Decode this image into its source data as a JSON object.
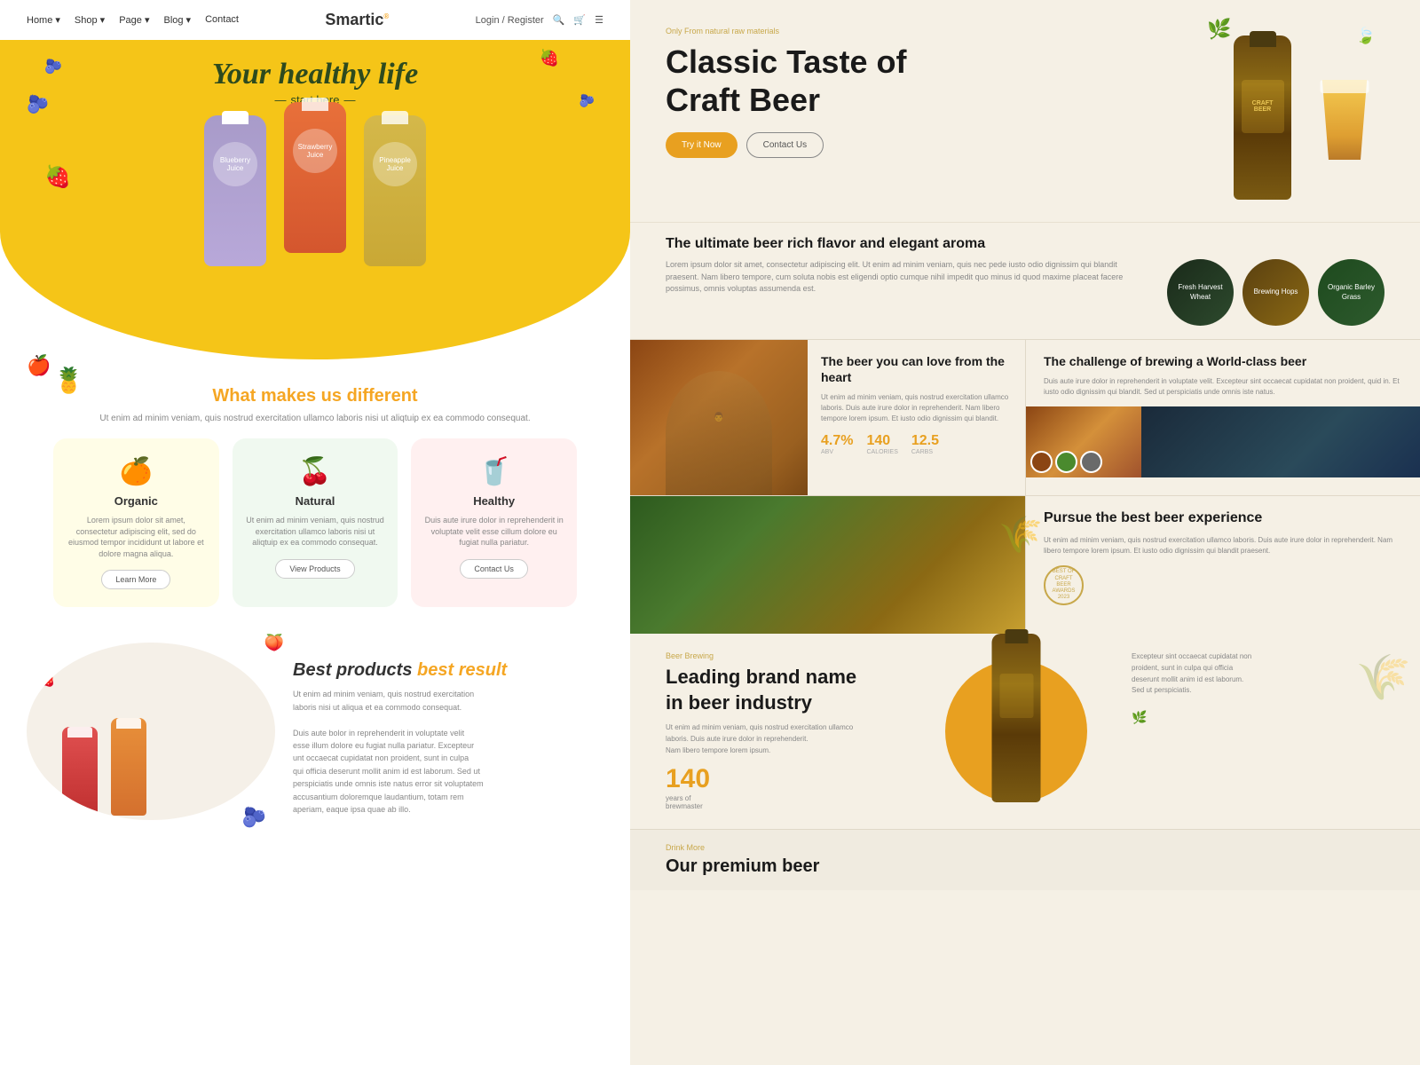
{
  "left": {
    "nav": {
      "links": [
        "Home ▾",
        "Shop ▾",
        "Page ▾",
        "Blog ▾",
        "Contact"
      ],
      "logo": "Smartic",
      "logo_sup": "®",
      "right": [
        "Login / Register",
        "🔍",
        "🛒",
        "☰"
      ]
    },
    "hero": {
      "title": "Your healthy life",
      "subtitle": "start here",
      "bottles": [
        {
          "color": "purple",
          "label": "Blueberry Juice"
        },
        {
          "color": "orange",
          "label": "Strawberry Juice"
        },
        {
          "color": "yellow",
          "label": "Pineapple Juice"
        }
      ]
    },
    "different": {
      "title_start": "What makes us ",
      "title_highlight": "different",
      "desc": "Ut enim ad minim veniam, quis nostrud exercitation ullamco\nlaboris nisi ut aliqtuip ex ea commodo consequat.",
      "cards": [
        {
          "name": "Organic",
          "icon": "🍊",
          "bg": "green",
          "desc": "Lorem ipsum dolor sit amet, consectetur adipiscing elit, sed do eiusmod tempor incididunt ut labore et dolore magna aliqua.",
          "btn": "Learn More"
        },
        {
          "name": "Natural",
          "icon": "🍒",
          "bg": "yellow",
          "desc": "Ut enim ad minim veniam, quis nostrud exercitation ullamco laboris nisi ut aliqtuip ex ea commodo consequat.",
          "btn": "View Products"
        },
        {
          "name": "Healthy",
          "icon": "🥤",
          "bg": "pink",
          "desc": "Duis aute irure dolor in reprehenderit in voluptate velit esse cillum dolore eu fugiat nulla pariatur.",
          "btn": "Contact Us"
        }
      ]
    },
    "products": {
      "label": "Best products",
      "label2": "best result",
      "desc": "Ut enim ad minim veniam, quis nostrud exercitation\nlaboris nisi ut aliqua et ea commodo consequat.\n\nDuis aute bolor in reprehenderit in voluptate velit\nesse illum dolore eu fugiat nulla pariatur. Excepteur\nunt occaecat cupidatat non proident, sunt in culpa\nqui officia deserunt mollit anim id est laborum. Sed ut\nperspiciatis unde omnis iste natus error sit voluptatem\naccusantium doloremque laudantium, totam rem\naperiam, eaque ipsa quae ab illo."
    }
  },
  "right": {
    "hero": {
      "label": "Only From natural raw materials",
      "title_line1": "Classic Taste of",
      "title_line2": "Craft Beer",
      "btn_try": "Try it Now",
      "btn_contact": "Contact Us"
    },
    "flavor": {
      "title": "The ultimate beer rich flavor and elegant aroma",
      "desc": "Lorem ipsum dolor sit amet, consectetur adipiscing elit. Ut enim ad minim veniam, quis nec pede iusto odio dignissim qui blandit praesent. Nam libero tempore, cum soluta nobis est eligendi optio cumque nihil impedit quo minus id quod maxime placeat facere possimus, omnis voluptas assumenda est.",
      "circles": [
        {
          "label": "Fresh\nHarvest\nWheat"
        },
        {
          "label": "Brewing\nHops"
        },
        {
          "label": "Organic\nBarley\nGrass"
        }
      ]
    },
    "cards": [
      {
        "title": "The beer you can love from the heart",
        "desc": "Ut enim ad minim veniam, quis nostrud exercitation ullamco laboris. Duis aute irure dolor in reprehenderit. Nam libero tempore lorem ipsum. Et iusto odio dignissim qui blandit.",
        "stats": [
          {
            "value": "4.7%",
            "label": "ABV"
          },
          {
            "value": "140",
            "label": "CALORIES"
          },
          {
            "value": "12.5",
            "label": "CARBS"
          }
        ]
      },
      {
        "title": "The challenge of brewing a World-class beer",
        "desc": "Duis aute irure dolor in reprehenderit in voluptate velit. Excepteur sint occaecat cupidatat non proident, quid in. Et iusto odio dignissim qui blandit. Sed ut perspiciatis unde omnis iste natus."
      }
    ],
    "pursue": {
      "title": "Pursue the best beer experience",
      "desc": "Ut enim ad minim veniam, quis nostrud exercitation ullamco laboris. Duis aute irure dolor in reprehenderit. Nam libero tempore lorem ipsum. Et iusto odio dignissim qui blandit praesent.",
      "badge_text": "BEST OF CRAFT\nBEER AWARDS 2023"
    },
    "leading": {
      "label": "Beer Brewing",
      "title_line1": "Leading brand name",
      "title_line2": "in beer industry",
      "desc": "Ut enim ad minim veniam, quis nostrud exercitation ullamco\nlaboris. Duis aute irure dolor in reprehenderit.\nNam libero tempore lorem ipsum.",
      "stat_value": "140",
      "stat_label": "years of\nbrewmaster",
      "right_desc": "Excepteur sint occaecat cupidatat non\nproident, sunt in culpa qui officia\ndeserunt mollit anim id est laborum.\nSed ut perspiciatis."
    },
    "premium": {
      "label": "Drink More",
      "title": "Our premium beer"
    }
  }
}
